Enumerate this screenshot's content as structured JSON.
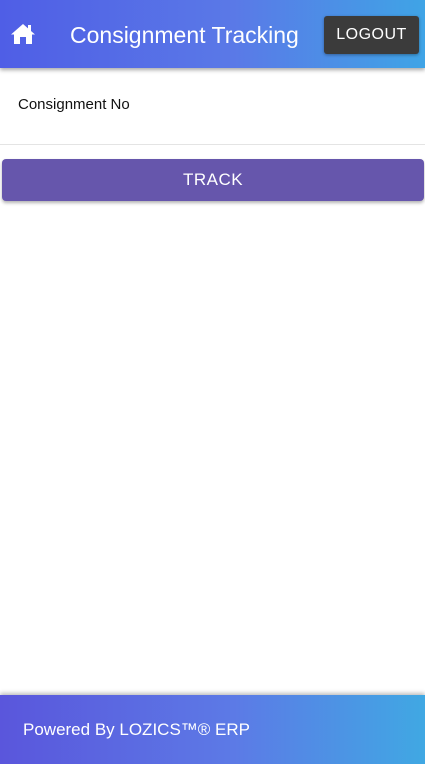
{
  "header": {
    "home_icon": "home-icon",
    "title": "Consignment Tracking",
    "logout_label": "LOGOUT"
  },
  "form": {
    "consignment_label": "Consignment No",
    "consignment_value": "",
    "track_label": "TRACK"
  },
  "footer": {
    "text": "Powered By LOZICS™® ERP"
  },
  "colors": {
    "header_gradient_start": "#4f5ee6",
    "header_gradient_end": "#3fa4e6",
    "logout_bg": "#3b3b3b",
    "track_bg": "#6656ac",
    "footer_gradient_start": "#5a56dc",
    "footer_gradient_end": "#40a8e3"
  }
}
